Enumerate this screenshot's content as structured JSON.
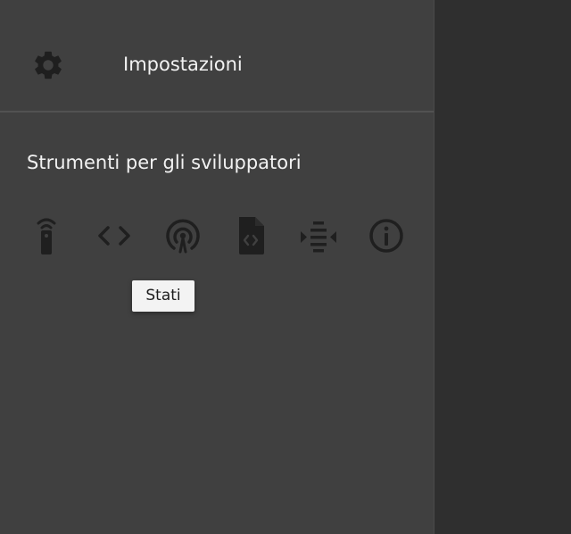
{
  "settings": {
    "label": "Impostazioni",
    "icon": "gear-icon"
  },
  "developer_tools": {
    "title": "Strumenti per gli sviluppatori",
    "tools": [
      {
        "name": "remote-icon"
      },
      {
        "name": "code-icon"
      },
      {
        "name": "broadcast-icon"
      },
      {
        "name": "code-file-icon"
      },
      {
        "name": "log-icon"
      },
      {
        "name": "info-icon"
      }
    ]
  },
  "tooltip": {
    "text": "Stati"
  },
  "colors": {
    "panel_background": "#404040",
    "right_background": "#2f2f2f",
    "icon_color": "#1f1f1f",
    "text_color": "#f2f2f2",
    "tooltip_background": "#f3f3f3"
  }
}
